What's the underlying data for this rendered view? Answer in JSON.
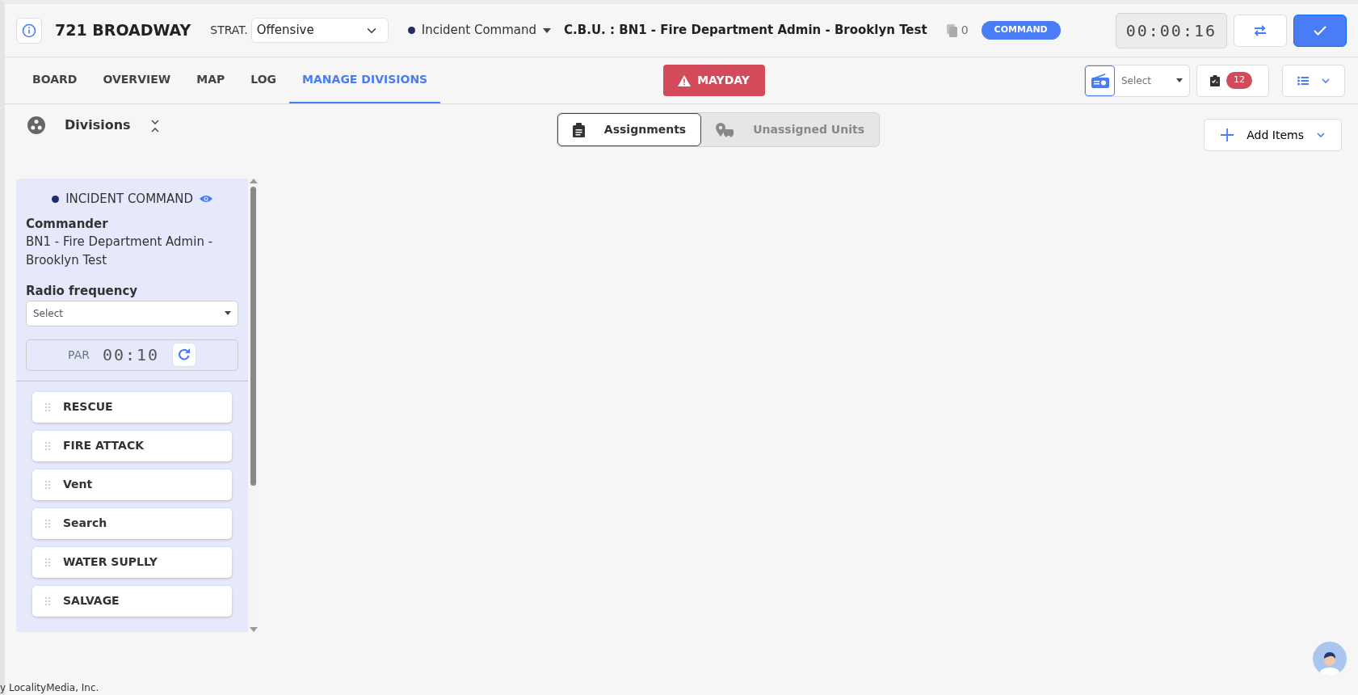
{
  "header": {
    "address": "721 BROADWAY",
    "strat_label": "STRAT.",
    "strategy": "Offensive",
    "role": {
      "label": "Incident Command",
      "color": "#1f2d6b"
    },
    "cbu": "C.B.U. : BN1 - Fire Department Admin - Brooklyn Test",
    "copies": "0",
    "badge": "COMMAND",
    "timer": "00:00:16"
  },
  "tabs": [
    {
      "label": "BOARD",
      "selected": false
    },
    {
      "label": "OVERVIEW",
      "selected": false
    },
    {
      "label": "MAP",
      "selected": false
    },
    {
      "label": "LOG",
      "selected": false
    },
    {
      "label": "MANAGE DIVISIONS",
      "selected": true
    }
  ],
  "mayday": "MAYDAY",
  "radio_select": {
    "placeholder": "Select"
  },
  "checklist_count": "12",
  "divisions_title": "Divisions",
  "view_toggle": [
    {
      "label": "Assignments",
      "selected": true
    },
    {
      "label": "Unassigned Units",
      "selected": false
    }
  ],
  "add_items": "Add Items",
  "panel": {
    "title": "INCIDENT COMMAND",
    "color": "#1f2d6b",
    "commander_label": "Commander",
    "commander": "BN1 - Fire Department Admin - Brooklyn Test",
    "radio_label": "Radio frequency",
    "radio_placeholder": "Select",
    "par_label": "PAR",
    "par_timer": "00:10",
    "divisions": [
      "RESCUE",
      "FIRE ATTACK",
      "Vent",
      "Search",
      "WATER SUPLLY",
      "SALVAGE"
    ]
  },
  "footer": "y LocalityMedia, Inc."
}
